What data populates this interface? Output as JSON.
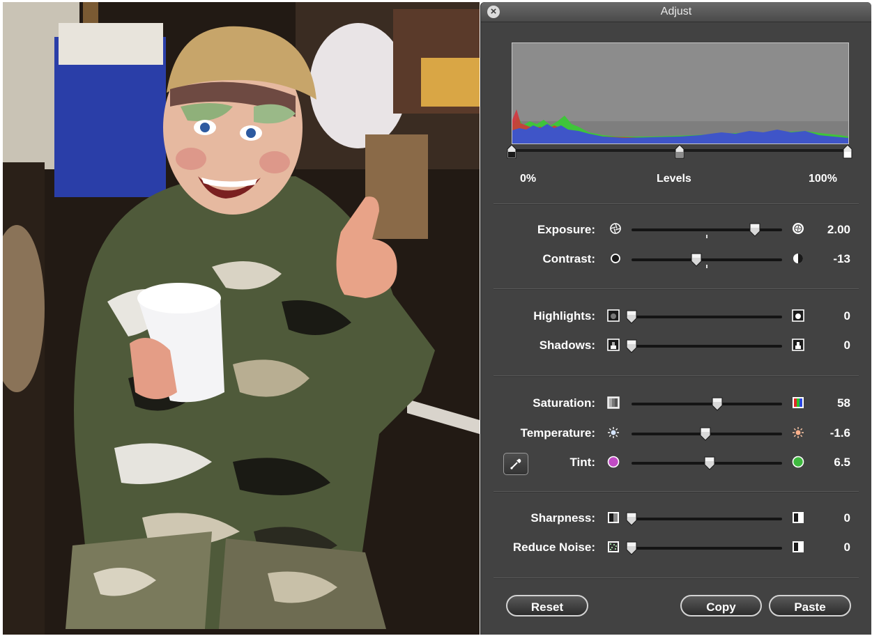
{
  "window": {
    "title": "Adjust"
  },
  "levels": {
    "min_label": "0%",
    "title": "Levels",
    "max_label": "100%",
    "black_point": 0.0,
    "gray_point": 0.5,
    "white_point": 1.0
  },
  "adjustments": {
    "exposure": {
      "label": "Exposure:",
      "value": "2.00",
      "position": 0.82,
      "left_icon": "aperture-icon",
      "right_icon": "bright-aperture-icon"
    },
    "contrast": {
      "label": "Contrast:",
      "value": "-13",
      "position": 0.43,
      "left_icon": "circle-icon",
      "right_icon": "half-circle-icon"
    },
    "highlights": {
      "label": "Highlights:",
      "value": "0",
      "position": 0.0,
      "left_icon": "highlights-low-icon",
      "right_icon": "highlights-high-icon"
    },
    "shadows": {
      "label": "Shadows:",
      "value": "0",
      "position": 0.0,
      "left_icon": "shadows-low-icon",
      "right_icon": "shadows-high-icon"
    },
    "saturation": {
      "label": "Saturation:",
      "value": "58",
      "position": 0.57,
      "left_icon": "grayscale-icon",
      "right_icon": "color-bars-icon"
    },
    "temperature": {
      "label": "Temperature:",
      "value": "-1.6",
      "position": 0.49,
      "left_icon": "cool-sun-icon",
      "right_icon": "warm-sun-icon"
    },
    "tint": {
      "label": "Tint:",
      "value": "6.5",
      "position": 0.52,
      "left_icon": "magenta-dot-icon",
      "right_icon": "green-dot-icon"
    },
    "sharpness": {
      "label": "Sharpness:",
      "value": "0",
      "position": 0.0,
      "left_icon": "sharpness-low-icon",
      "right_icon": "sharpness-high-icon"
    },
    "reduce_noise": {
      "label": "Reduce Noise:",
      "value": "0",
      "position": 0.0,
      "left_icon": "noise-icon",
      "right_icon": "noise-reduced-icon"
    }
  },
  "buttons": {
    "reset": "Reset",
    "copy": "Copy",
    "paste": "Paste"
  },
  "colors": {
    "panel_bg": "#424242",
    "histogram_bg": "#8a8a8a",
    "histogram_blue": "#3f55c8",
    "histogram_green": "#3fc43a",
    "histogram_red": "#d8303a",
    "tint_magenta": "#c14bc4",
    "tint_green": "#3fb83f"
  }
}
